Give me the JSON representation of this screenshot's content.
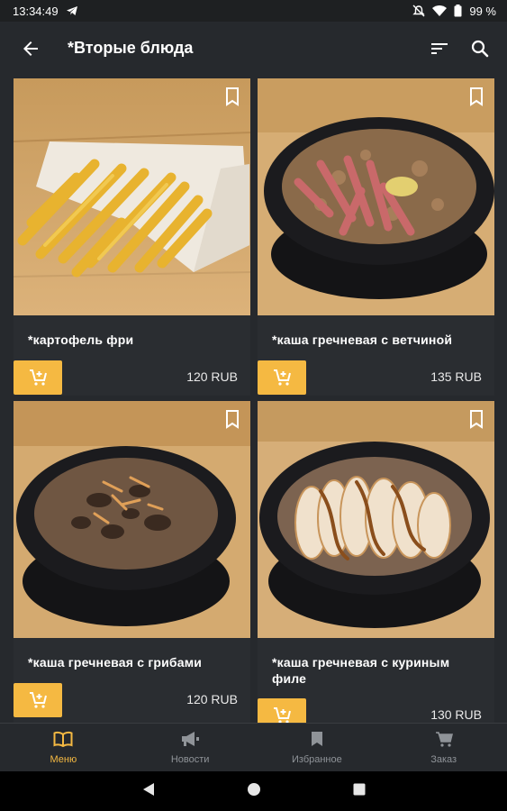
{
  "status": {
    "time": "13:34:49",
    "battery": "99 %"
  },
  "appbar": {
    "title": "*Вторые блюда"
  },
  "products": [
    {
      "name": "*картофель фри",
      "price": "120 RUB"
    },
    {
      "name": "*каша гречневая с ветчиной",
      "price": "135 RUB"
    },
    {
      "name": "*каша гречневая с грибами",
      "price": "120 RUB"
    },
    {
      "name": "*каша гречневая с куриным филе",
      "price": "130 RUB"
    }
  ],
  "nav": [
    {
      "label": "Меню",
      "icon": "book-icon",
      "active": true
    },
    {
      "label": "Новости",
      "icon": "megaphone-icon"
    },
    {
      "label": "Избранное",
      "icon": "bookmark-icon"
    },
    {
      "label": "Заказ",
      "icon": "cart-icon"
    }
  ],
  "colors": {
    "accent": "#f5b942",
    "background": "#26292d",
    "card": "#2a2d31"
  }
}
